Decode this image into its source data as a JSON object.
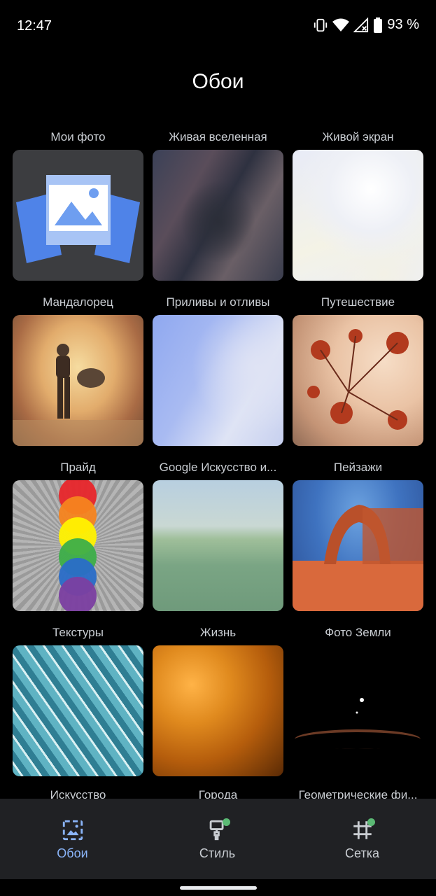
{
  "status": {
    "time": "12:47",
    "battery": "93 %"
  },
  "header": {
    "title": "Обои"
  },
  "categories": [
    {
      "label": "Мои фото"
    },
    {
      "label": "Живая вселенная"
    },
    {
      "label": "Живой экран"
    },
    {
      "label": "Мандалорец"
    },
    {
      "label": "Приливы и отливы"
    },
    {
      "label": "Путешествие"
    },
    {
      "label": "Прайд"
    },
    {
      "label": "Google Искусство и..."
    },
    {
      "label": "Пейзажи"
    },
    {
      "label": "Текстуры"
    },
    {
      "label": "Жизнь"
    },
    {
      "label": "Фото Земли"
    }
  ],
  "partial_categories": [
    {
      "label": "Искусство"
    },
    {
      "label": "Города"
    },
    {
      "label": "Геометрические фи..."
    }
  ],
  "nav": {
    "items": [
      {
        "label": "Обои",
        "icon": "wallpaper-icon",
        "active": true
      },
      {
        "label": "Стиль",
        "icon": "paint-brush-icon",
        "badge": true
      },
      {
        "label": "Сетка",
        "icon": "grid-icon",
        "badge": true
      }
    ],
    "accent": "#8ab4f8",
    "badge_color": "#5bb974"
  }
}
